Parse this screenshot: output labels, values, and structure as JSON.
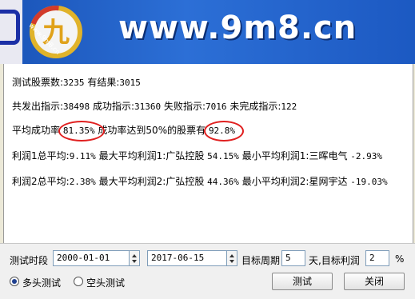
{
  "banner": {
    "url_text": "www.9m8.cn",
    "logo_text": "www.9m8.cn",
    "logo_glyph": "九"
  },
  "stats": {
    "total_label": "测试股票数:",
    "total_value": "3235",
    "result_label": "有结果:",
    "result_value": "3015",
    "signals_label": "共发出指示:",
    "signals_value": "38498",
    "success_label": "成功指示:",
    "success_value": "31360",
    "fail_label": "失败指示:",
    "fail_value": "7016",
    "incomplete_label": "未完成指示:",
    "incomplete_value": "122",
    "avg_success_label": "平均成功率",
    "avg_success_value": "81.35%",
    "rate_50_label": "成功率达到50%的股票有",
    "rate_50_value": "92.8%",
    "p1_avg_label": "利润1总平均:",
    "p1_avg_value": "9.11%",
    "p1_max_label": "最大平均利润1:",
    "p1_max_name": "广弘控股",
    "p1_max_value": "54.15%",
    "p1_min_label": "最小平均利润1:",
    "p1_min_name": "三晖电气",
    "p1_min_value": "-2.93%",
    "p2_avg_label": "利润2总平均:",
    "p2_avg_value": "2.38%",
    "p2_max_label": "最大平均利润2:",
    "p2_max_name": "广弘控股",
    "p2_max_value": "44.36%",
    "p2_min_label": "最小平均利润2:",
    "p2_min_name": "星网宇达",
    "p2_min_value": "-19.03%"
  },
  "controls": {
    "period_label": "测试时段",
    "start_date": "2000-01-01",
    "end_date": "2017-06-15",
    "target_period_label": "目标周期",
    "target_period_value": "5",
    "day_label": "天,目标利润",
    "target_profit_value": "2",
    "percent_label": "%",
    "long_test_label": "多头测试",
    "short_test_label": "空头测试",
    "test_button": "测试",
    "close_button": "关闭"
  },
  "colors": {
    "banner": "#2c6fd6",
    "circle": "#e02020",
    "window_bg": "#ece9d8"
  }
}
